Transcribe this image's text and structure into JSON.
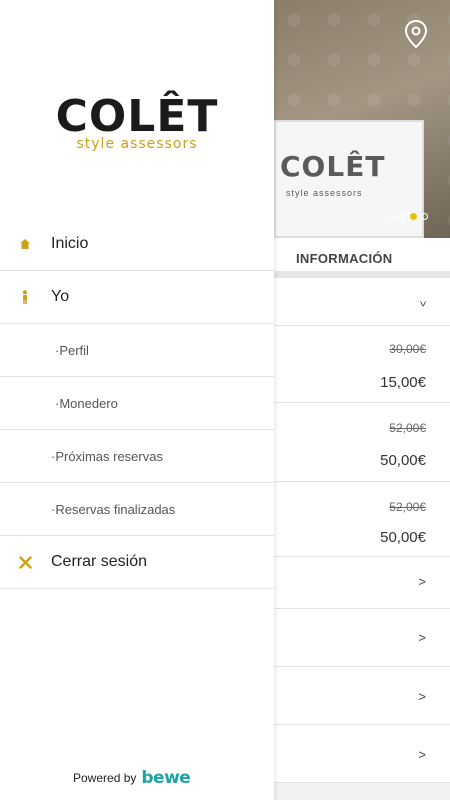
{
  "drawer": {
    "logo_name": "COLÊT",
    "logo_tagline": "style assessors",
    "menu": [
      {
        "label": "Inicio",
        "icon": "home-icon"
      },
      {
        "label": "Yo",
        "icon": "person-icon"
      },
      {
        "label": "·Perfil"
      },
      {
        "label": "·Monedero"
      },
      {
        "label": "·Próximas reservas"
      },
      {
        "label": "·Reservas finalizadas"
      },
      {
        "label": "Cerrar sesión",
        "icon": "close-icon"
      }
    ],
    "powered_by": "Powered by",
    "powered_brand": "bewe"
  },
  "background": {
    "hero_brand": "COLÊT",
    "hero_sub": "style assessors",
    "carousel": {
      "count": 4,
      "active_index": 2
    },
    "section_title": "INFORMACIÓN",
    "rows": [
      {
        "type": "chevron",
        "symbol": "^"
      },
      {
        "type": "price",
        "old": "30,00€",
        "new": "15,00€"
      },
      {
        "type": "price",
        "old": "52,00€",
        "new": "50,00€"
      },
      {
        "type": "price",
        "old": "52,00€",
        "new": "50,00€"
      },
      {
        "type": "chevron",
        "symbol": ">"
      },
      {
        "type": "chevron",
        "symbol": ">"
      },
      {
        "type": "chevron",
        "symbol": ">"
      },
      {
        "type": "chevron",
        "symbol": ">"
      }
    ]
  },
  "colors": {
    "accent": "#c9a21a",
    "brand_teal": "#1fa3a3"
  }
}
